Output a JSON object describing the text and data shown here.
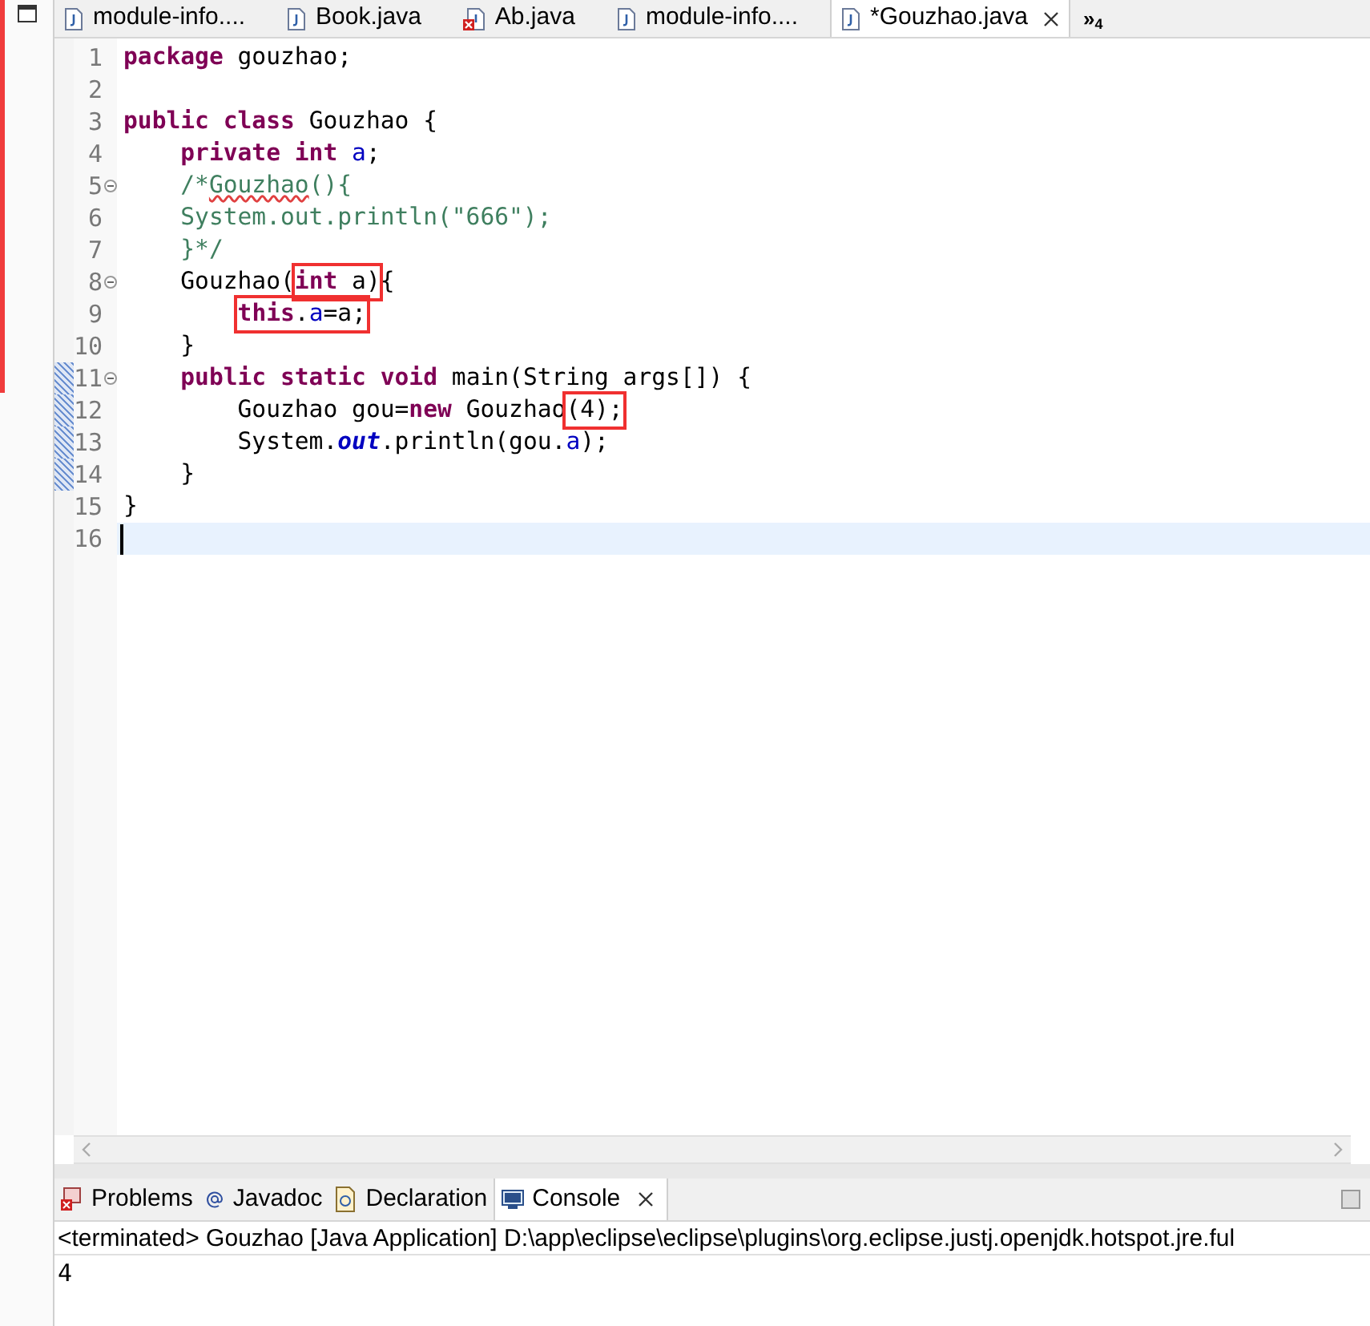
{
  "editor_tabs": [
    {
      "label": "module-info....",
      "error": false,
      "selected": false,
      "closable": false
    },
    {
      "label": "Book.java",
      "error": false,
      "selected": false,
      "closable": false
    },
    {
      "label": "Ab.java",
      "error": true,
      "selected": false,
      "closable": false
    },
    {
      "label": "module-info....",
      "error": false,
      "selected": false,
      "closable": false
    },
    {
      "label": "*Gouzhao.java",
      "error": false,
      "selected": true,
      "closable": true
    }
  ],
  "tab_overflow": {
    "symbol": "»",
    "count": "4"
  },
  "code_lines": [
    {
      "number": "1",
      "fold": false,
      "changed": false,
      "current": false,
      "tokens": [
        {
          "kind": "keyword",
          "text": "package"
        },
        {
          "kind": "plain",
          "text": " gouzhao;"
        }
      ]
    },
    {
      "number": "2",
      "fold": false,
      "changed": false,
      "current": false
    },
    {
      "number": "3",
      "fold": false,
      "changed": false,
      "current": false,
      "tokens": [
        {
          "kind": "keyword",
          "text": "public class"
        },
        {
          "kind": "plain",
          "text": " Gouzhao {"
        }
      ]
    },
    {
      "number": "4",
      "fold": false,
      "changed": false,
      "current": false,
      "tokens": [
        {
          "kind": "keyword",
          "text": "    private int "
        },
        {
          "kind": "field",
          "text": "a"
        },
        {
          "kind": "plain",
          "text": ";"
        }
      ]
    },
    {
      "number": "5",
      "fold": true,
      "changed": false,
      "current": false,
      "tokens": [
        {
          "kind": "comment",
          "text": "    /*"
        },
        {
          "kind": "misspelled",
          "text": "Gouzhao"
        },
        {
          "kind": "comment",
          "text": "(){"
        }
      ]
    },
    {
      "number": "6",
      "fold": false,
      "changed": false,
      "current": false,
      "tokens": [
        {
          "kind": "comment",
          "text": "    System.out.println(\"666\");"
        }
      ]
    },
    {
      "number": "7",
      "fold": false,
      "changed": false,
      "current": false,
      "tokens": [
        {
          "kind": "comment",
          "text": "    }*/"
        }
      ]
    },
    {
      "number": "8",
      "fold": true,
      "changed": false,
      "current": false,
      "tokens": [
        {
          "kind": "plain",
          "text": "    Gouzhao("
        },
        {
          "kind": "box",
          "parts": [
            {
              "kind": "keyword",
              "text": "int"
            },
            {
              "kind": "plain",
              "text": " a)"
            }
          ]
        },
        {
          "kind": "plain",
          "text": "{"
        }
      ]
    },
    {
      "number": "9",
      "fold": false,
      "changed": false,
      "current": false,
      "tokens": [
        {
          "kind": "box",
          "parts": [
            {
              "kind": "keyword",
              "text": "        this"
            },
            {
              "kind": "plain",
              "text": "."
            },
            {
              "kind": "field",
              "text": "a"
            },
            {
              "kind": "plain",
              "text": "=a;"
            }
          ]
        }
      ]
    },
    {
      "number": "10",
      "fold": false,
      "changed": false,
      "current": false,
      "tokens": [
        {
          "kind": "plain",
          "text": "    }"
        }
      ]
    },
    {
      "number": "11",
      "fold": true,
      "changed": true,
      "current": false,
      "tokens": [
        {
          "kind": "keyword",
          "text": "    public static void"
        },
        {
          "kind": "plain",
          "text": " main(String args[]) {"
        }
      ]
    },
    {
      "number": "12",
      "fold": false,
      "changed": true,
      "current": false,
      "tokens": [
        {
          "kind": "plain",
          "text": "        Gouzhao gou="
        },
        {
          "kind": "keyword",
          "text": "new"
        },
        {
          "kind": "plain",
          "text": " Gouzhao"
        },
        {
          "kind": "box",
          "parts": [
            {
              "kind": "plain",
              "text": "(4);"
            }
          ]
        }
      ]
    },
    {
      "number": "13",
      "fold": false,
      "changed": true,
      "current": false,
      "tokens": [
        {
          "kind": "plain",
          "text": "        System."
        },
        {
          "kind": "static",
          "text": "out"
        },
        {
          "kind": "plain",
          "text": ".println(gou."
        },
        {
          "kind": "field",
          "text": "a"
        },
        {
          "kind": "plain",
          "text": ");"
        }
      ]
    },
    {
      "number": "14",
      "fold": false,
      "changed": true,
      "current": false,
      "tokens": [
        {
          "kind": "plain",
          "text": "    }"
        }
      ]
    },
    {
      "number": "15",
      "fold": false,
      "changed": false,
      "current": false,
      "tokens": [
        {
          "kind": "plain",
          "text": "}"
        }
      ]
    },
    {
      "number": "16",
      "fold": false,
      "changed": false,
      "current": true
    }
  ],
  "bottom_tabs": [
    {
      "label": "Problems",
      "selected": false,
      "closable": false
    },
    {
      "label": "Javadoc",
      "selected": false,
      "closable": false
    },
    {
      "label": "Declaration",
      "selected": false,
      "closable": false
    },
    {
      "label": "Console",
      "selected": true,
      "closable": true
    }
  ],
  "console": {
    "header": "<terminated> Gouzhao [Java Application] D:\\app\\eclipse\\eclipse\\plugins\\org.eclipse.justj.openjdk.hotspot.jre.ful",
    "output": "4"
  }
}
